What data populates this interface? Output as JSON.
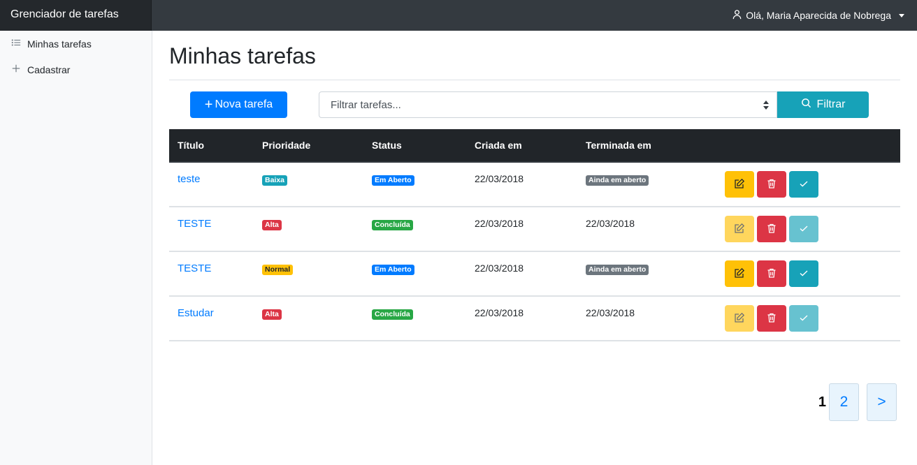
{
  "app": {
    "brand": "Grenciador de tarefas"
  },
  "user_menu": {
    "greeting": "Olá, Maria Aparecida de Nobrega"
  },
  "sidebar": {
    "items": [
      {
        "label": "Minhas tarefas",
        "icon": "list-icon"
      },
      {
        "label": "Cadastrar",
        "icon": "plus-icon"
      }
    ]
  },
  "page": {
    "title": "Minhas tarefas"
  },
  "toolbar": {
    "new_task_label": "Nova tarefa",
    "filter_placeholder": "Filtrar tarefas...",
    "filter_button_label": "Filtrar"
  },
  "table": {
    "headers": [
      "Título",
      "Prioridade",
      "Status",
      "Criada em",
      "Terminada em"
    ],
    "rows": [
      {
        "title": "teste",
        "priority": "Baixa",
        "status": "Em Aberto",
        "created": "22/03/2018",
        "finished": "Ainda em aberto",
        "finished_is_badge": true,
        "done": false
      },
      {
        "title": "TESTE",
        "priority": "Alta",
        "status": "Concluída",
        "created": "22/03/2018",
        "finished": "22/03/2018",
        "finished_is_badge": false,
        "done": true
      },
      {
        "title": "TESTE",
        "priority": "Normal",
        "status": "Em Aberto",
        "created": "22/03/2018",
        "finished": "Ainda em aberto",
        "finished_is_badge": true,
        "done": false
      },
      {
        "title": "Estudar",
        "priority": "Alta",
        "status": "Concluída",
        "created": "22/03/2018",
        "finished": "22/03/2018",
        "finished_is_badge": false,
        "done": true
      }
    ]
  },
  "pagination": {
    "current": "1",
    "pages": [
      "2"
    ],
    "next": ">"
  },
  "colors": {
    "primary": "#007bff",
    "info": "#17a2b8",
    "danger": "#dc3545",
    "warning": "#ffc107",
    "success": "#28a745",
    "secondary": "#6c757d",
    "navbar": "#343a40"
  }
}
